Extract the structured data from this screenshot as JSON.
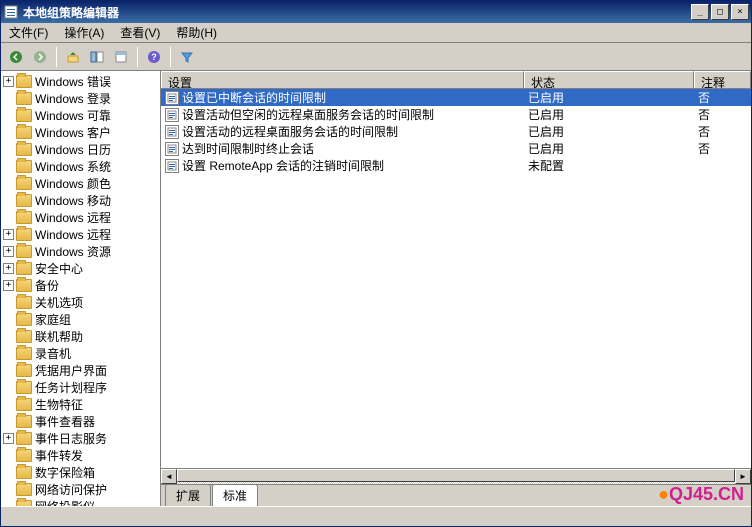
{
  "window": {
    "title": "本地组策略编辑器",
    "minimize": "_",
    "maximize": "□",
    "close": "×"
  },
  "menubar": {
    "file": "文件(F)",
    "action": "操作(A)",
    "view": "查看(V)",
    "help": "帮助(H)"
  },
  "tree": {
    "items": [
      {
        "t": "+",
        "label": "Windows 错误"
      },
      {
        "t": "",
        "label": "Windows 登录"
      },
      {
        "t": "",
        "label": "Windows 可靠"
      },
      {
        "t": "",
        "label": "Windows 客户"
      },
      {
        "t": "",
        "label": "Windows 日历"
      },
      {
        "t": "",
        "label": "Windows 系统"
      },
      {
        "t": "",
        "label": "Windows 颜色"
      },
      {
        "t": "",
        "label": "Windows 移动"
      },
      {
        "t": "",
        "label": "Windows 远程"
      },
      {
        "t": "+",
        "label": "Windows 远程"
      },
      {
        "t": "+",
        "label": "Windows 资源"
      },
      {
        "t": "+",
        "label": "安全中心"
      },
      {
        "t": "+",
        "label": "备份"
      },
      {
        "t": "",
        "label": "关机选项"
      },
      {
        "t": "",
        "label": "家庭组"
      },
      {
        "t": "",
        "label": "联机帮助"
      },
      {
        "t": "",
        "label": "录音机"
      },
      {
        "t": "",
        "label": "凭据用户界面"
      },
      {
        "t": "",
        "label": "任务计划程序"
      },
      {
        "t": "",
        "label": "生物特征"
      },
      {
        "t": "",
        "label": "事件查看器"
      },
      {
        "t": "+",
        "label": "事件日志服务"
      },
      {
        "t": "",
        "label": "事件转发"
      },
      {
        "t": "",
        "label": "数字保险箱"
      },
      {
        "t": "",
        "label": "网络访问保护"
      },
      {
        "t": "",
        "label": "网络投影仪"
      }
    ]
  },
  "list": {
    "columns": {
      "setting": "设置",
      "status": "状态",
      "comment": "注释"
    },
    "rows": [
      {
        "setting": "设置已中断会话的时间限制",
        "status": "已启用",
        "comment": "否",
        "selected": true
      },
      {
        "setting": "设置活动但空闲的远程桌面服务会话的时间限制",
        "status": "已启用",
        "comment": "否"
      },
      {
        "setting": "设置活动的远程桌面服务会话的时间限制",
        "status": "已启用",
        "comment": "否"
      },
      {
        "setting": "达到时间限制时终止会话",
        "status": "已启用",
        "comment": "否"
      },
      {
        "setting": "设置 RemoteApp 会话的注销时间限制",
        "status": "未配置",
        "comment": ""
      }
    ]
  },
  "tabs": {
    "extended": "扩展",
    "standard": "标准"
  },
  "watermark": "QJ45.CN"
}
